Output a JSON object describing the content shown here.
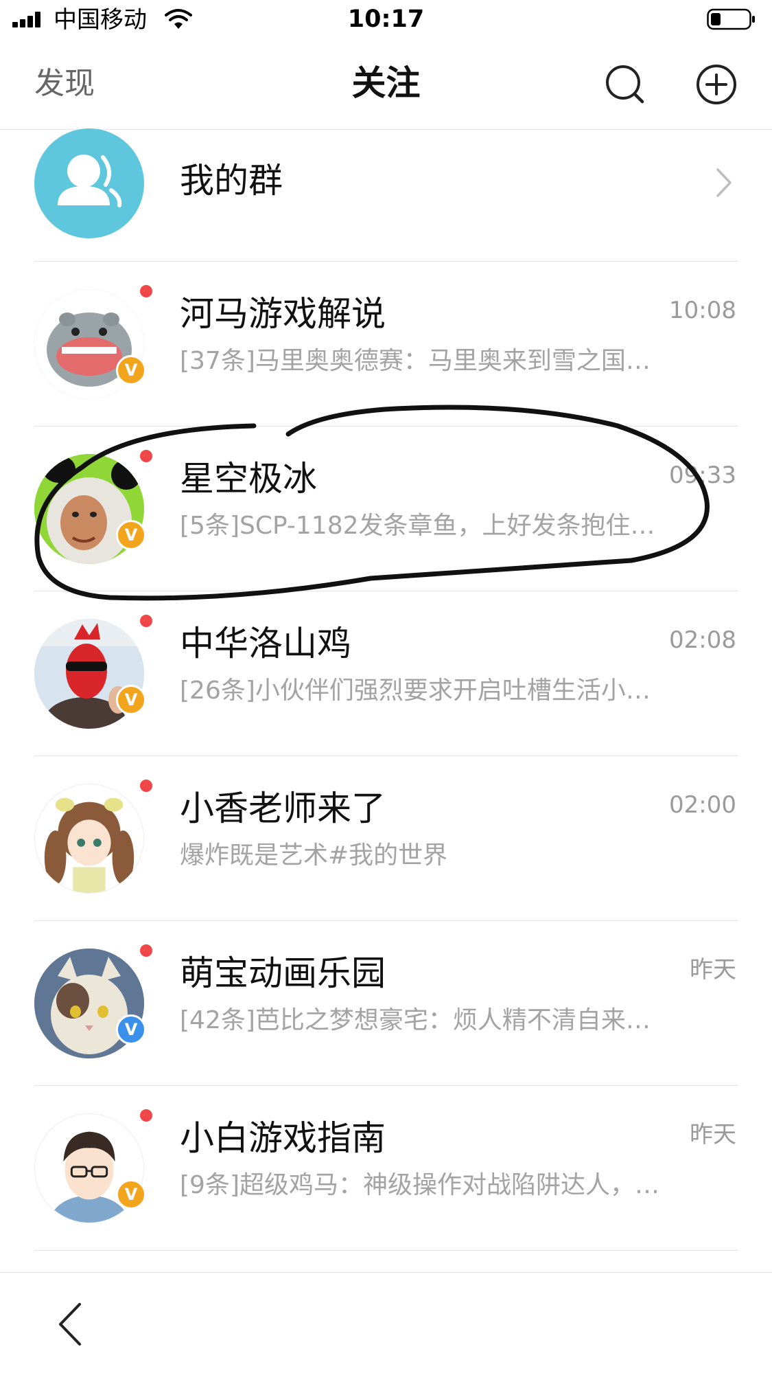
{
  "status_bar": {
    "carrier": "中国移动",
    "time": "10:17"
  },
  "navbar": {
    "left_label": "发现",
    "title": "关注",
    "icons": [
      "search-icon",
      "add-circle-icon"
    ]
  },
  "group_row": {
    "label": "我的群",
    "icon": "group-icon",
    "avatar_color": "#5ec6dd"
  },
  "accounts": [
    {
      "name": "河马游戏解说",
      "time": "10:08",
      "preview": "[37条]马里奥奥德赛：马里奥来到雪之国…",
      "badge": "V",
      "badge_color": "gold",
      "avatar_color": "#9aa3a8"
    },
    {
      "name": "星空极冰",
      "time": "09:33",
      "preview": "[5条]SCP-1182发条章鱼，上好发条抱住…",
      "badge": "V",
      "badge_color": "gold",
      "avatar_color": "#8fd636"
    },
    {
      "name": "中华洛山鸡",
      "time": "02:08",
      "preview": "[26条]小伙伴们强烈要求开启吐槽生活小…",
      "badge": "V",
      "badge_color": "gold",
      "avatar_color": "#c9d8e6"
    },
    {
      "name": "小香老师来了",
      "time": "02:00",
      "preview": "爆炸既是艺术#我的世界",
      "badge": "",
      "badge_color": "",
      "avatar_color": "#f4efe4"
    },
    {
      "name": "萌宝动画乐园",
      "time": "昨天",
      "preview": "[42条]芭比之梦想豪宅：烦人精不清自来…",
      "badge": "V",
      "badge_color": "blue",
      "avatar_color": "#6f86a3"
    },
    {
      "name": "小白游戏指南",
      "time": "昨天",
      "preview": "[9条]超级鸡马：神级操作对战陷阱达人，…",
      "badge": "V",
      "badge_color": "gold",
      "avatar_color": "#eef2f6"
    }
  ],
  "colors": {
    "unread_dot": "#f04848",
    "badge_gold": "#f3a41d",
    "badge_blue": "#3a90ea",
    "preview_text": "#a3a3a3"
  }
}
